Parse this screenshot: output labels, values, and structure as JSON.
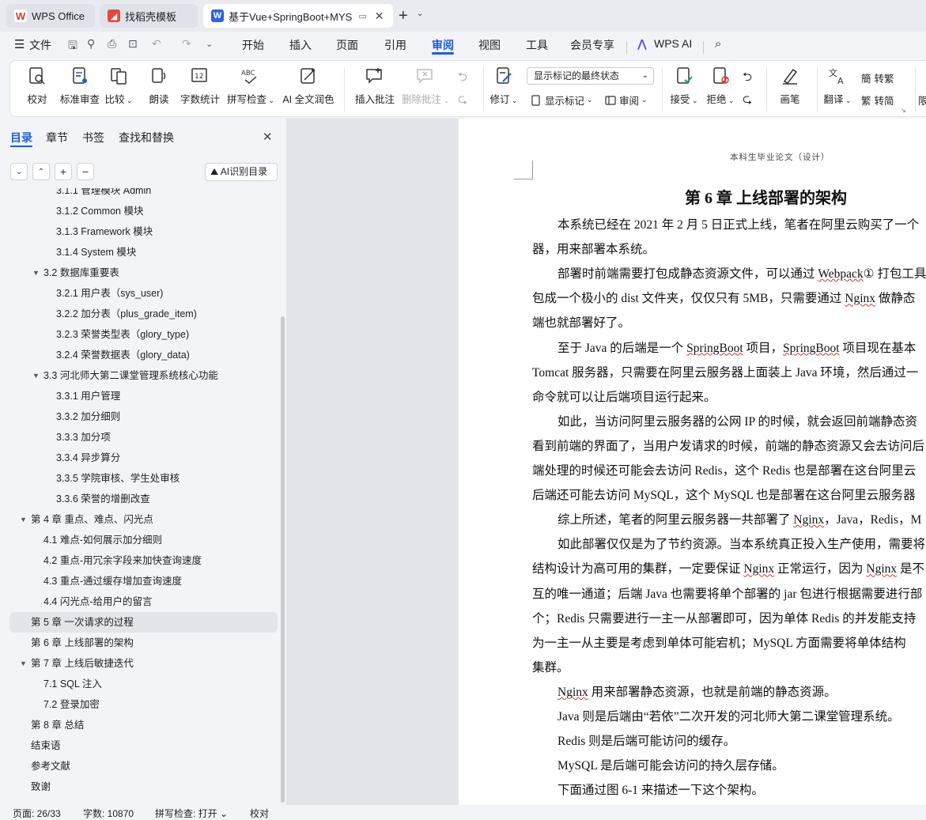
{
  "tabs": [
    {
      "label": "WPS Office"
    },
    {
      "label": "找稻壳模板"
    },
    {
      "label": "基于Vue+SpringBoot+MYS"
    }
  ],
  "menu": {
    "file": "文件",
    "items": [
      "开始",
      "插入",
      "页面",
      "引用",
      "审阅",
      "视图",
      "工具",
      "会员专享"
    ],
    "active": "审阅",
    "wps_ai": "WPS AI"
  },
  "ribbon": {
    "proofread": "校对",
    "standard_review": "标准审查",
    "compare": "比较",
    "read_aloud": "朗读",
    "word_count": "字数统计",
    "spell_check": "拼写检查",
    "ai_polish": "AI 全文润色",
    "insert_comment": "插入批注",
    "delete_comment": "删除批注",
    "revise": "修订",
    "display_mode": "显示标记的最终状态",
    "show_markup": "显示标记",
    "review": "审阅",
    "accept": "接受",
    "reject": "拒绝",
    "pen": "画笔",
    "translate": "翻译",
    "to_traditional": "转繁",
    "to_simplified": "转简",
    "limit": "限"
  },
  "panel": {
    "tabs": [
      "目录",
      "章节",
      "书签",
      "查找和替换"
    ],
    "ai_toc": "AI识别目录",
    "toc": [
      {
        "text": "3.1.1  管理模块 Admin",
        "level": 3
      },
      {
        "text": "3.1.2  Common 模块",
        "level": 3
      },
      {
        "text": "3.1.3  Framework 模块",
        "level": 3
      },
      {
        "text": "3.1.4  System 模块",
        "level": 3
      },
      {
        "text": "3.2  数据库重要表",
        "level": 2,
        "caret": true
      },
      {
        "text": "3.2.1  用户表（sys_user)",
        "level": 3
      },
      {
        "text": "3.2.2  加分表（plus_grade_item)",
        "level": 3
      },
      {
        "text": "3.2.3  荣誉类型表（glory_type)",
        "level": 3
      },
      {
        "text": "3.2.4  荣誉数据表（glory_data)",
        "level": 3
      },
      {
        "text": "3.3  河北师大第二课堂管理系统核心功能",
        "level": 2,
        "caret": true
      },
      {
        "text": "3.3.1  用户管理",
        "level": 3
      },
      {
        "text": "3.3.2  加分细则",
        "level": 3
      },
      {
        "text": "3.3.3  加分项",
        "level": 3
      },
      {
        "text": "3.3.4  异步算分",
        "level": 3
      },
      {
        "text": "3.3.5  学院审核、学生处审核",
        "level": 3
      },
      {
        "text": "3.3.6  荣誉的增删改查",
        "level": 3
      },
      {
        "text": "第 4 章    重点、难点、闪光点",
        "level": 1,
        "caret": true
      },
      {
        "text": "4.1  难点-如何展示加分细则",
        "level": 2
      },
      {
        "text": "4.2  重点-用冗余字段来加快查询速度",
        "level": 2
      },
      {
        "text": "4.3  重点-通过缓存增加查询速度",
        "level": 2
      },
      {
        "text": "4.4  闪光点-给用户的留言",
        "level": 2
      },
      {
        "text": "第 5 章    一次请求的过程",
        "level": 1,
        "selected": true
      },
      {
        "text": "第 6 章    上线部署的架构",
        "level": 1
      },
      {
        "text": "第 7 章  上线后敏捷迭代",
        "level": 1,
        "caret": true
      },
      {
        "text": "7.1 SQL 注入",
        "level": 2
      },
      {
        "text": "7.2  登录加密",
        "level": 2
      },
      {
        "text": "第 8 章    总结",
        "level": 1
      },
      {
        "text": "结束语",
        "level": 1
      },
      {
        "text": "参考文献",
        "level": 1
      },
      {
        "text": "致谢",
        "level": 1
      }
    ]
  },
  "document": {
    "header": "本科生毕业论文（设计）",
    "title": "第 6 章    上线部署的架构",
    "lines": [
      {
        "segs": [
          {
            "t": "本系统已经在 2021 年 2 月 5 日正式上线，笔者在阿里云购买了一个"
          }
        ],
        "indent": true
      },
      {
        "segs": [
          {
            "t": "器，用来部署本系统。"
          }
        ]
      },
      {
        "segs": [
          {
            "t": "部署时前端需要打包成静态资源文件，可以通过 "
          },
          {
            "t": "Webpack",
            "u": true
          },
          {
            "t": "① 打包工具"
          }
        ],
        "indent": true
      },
      {
        "segs": [
          {
            "t": "包成一个极小的 dist 文件夹，仅仅只有 5MB，只需要通过 "
          },
          {
            "t": "Nginx",
            "u": true
          },
          {
            "t": " 做静态"
          }
        ]
      },
      {
        "segs": [
          {
            "t": "端也就部署好了。"
          }
        ]
      },
      {
        "segs": [
          {
            "t": "至于 Java 的后端是一个 "
          },
          {
            "t": "SpringBoot",
            "u": true
          },
          {
            "t": " 项目，"
          },
          {
            "t": "SpringBoot",
            "u": true
          },
          {
            "t": " 项目现在基本"
          }
        ],
        "indent": true
      },
      {
        "segs": [
          {
            "t": "Tomcat 服务器，只需要在阿里云服务器上面装上 Java 环境，然后通过一"
          }
        ]
      },
      {
        "segs": [
          {
            "t": "命令就可以让后端项目运行起来。"
          }
        ]
      },
      {
        "segs": [
          {
            "t": "如此，当访问阿里云服务器的公网 IP 的时候，就会返回前端静态资"
          }
        ],
        "indent": true
      },
      {
        "segs": [
          {
            "t": "看到前端的界面了，当用户发请求的时候，前端的静态资源又会去访问后"
          }
        ]
      },
      {
        "segs": [
          {
            "t": "端处理的时候还可能会去访问 Redis，这个 Redis 也是部署在这台阿里云"
          }
        ]
      },
      {
        "segs": [
          {
            "t": "后端还可能去访问 MySQL，这个 MySQL 也是部署在这台阿里云服务器"
          }
        ]
      },
      {
        "segs": [
          {
            "t": "综上所述，笔者的阿里云服务器一共部署了 "
          },
          {
            "t": "Nginx",
            "u": true
          },
          {
            "t": "，Java，Redis，M"
          }
        ],
        "indent": true
      },
      {
        "segs": [
          {
            "t": "如此部署仅仅是为了节约资源。当本系统真正投入生产使用，需要将"
          }
        ],
        "indent": true
      },
      {
        "segs": [
          {
            "t": "结构设计为高可用的集群，一定要保证 "
          },
          {
            "t": "Nginx",
            "u": true
          },
          {
            "t": " 正常运行，因为 "
          },
          {
            "t": "Nginx",
            "u": true
          },
          {
            "t": " 是不"
          }
        ]
      },
      {
        "segs": [
          {
            "t": "互的唯一通道；后端 Java 也需要将单个部署的 jar 包进行根据需要进行部"
          }
        ]
      },
      {
        "segs": [
          {
            "t": "个；Redis 只需要进行一主一从部署即可，因为单体 Redis 的并发能支持"
          }
        ]
      },
      {
        "segs": [
          {
            "t": "为一主一从主要是考虑到单体可能宕机；MySQL 方面需要将单体结构"
          }
        ]
      },
      {
        "segs": [
          {
            "t": "集群。"
          }
        ]
      },
      {
        "segs": [
          {
            "t": "Nginx",
            "u": true
          },
          {
            "t": " 用来部署静态资源，也就是前端的静态资源。"
          }
        ],
        "indent": true
      },
      {
        "segs": [
          {
            "t": "Java 则是后端由“若依”二次开发的河北师大第二课堂管理系统。"
          }
        ],
        "indent": true
      },
      {
        "segs": [
          {
            "t": "Redis 则是后端可能访问的缓存。"
          }
        ],
        "indent": true
      },
      {
        "segs": [
          {
            "t": "MySQL 是后端可能会访问的持久层存储。"
          }
        ],
        "indent": true
      },
      {
        "segs": [
          {
            "t": "下面通过图 6-1 来描述一下这个架构。"
          }
        ],
        "indent": true
      }
    ]
  },
  "status": {
    "page": "页面: 26/33",
    "words": "字数: 10870",
    "spell": "拼写检查: 打开",
    "proof": "校对"
  },
  "colors": {
    "accent": "#1b5fd9",
    "wps_red": "#e03a2e",
    "docer": "#e8473c",
    "word_blue": "#2b63e0"
  }
}
